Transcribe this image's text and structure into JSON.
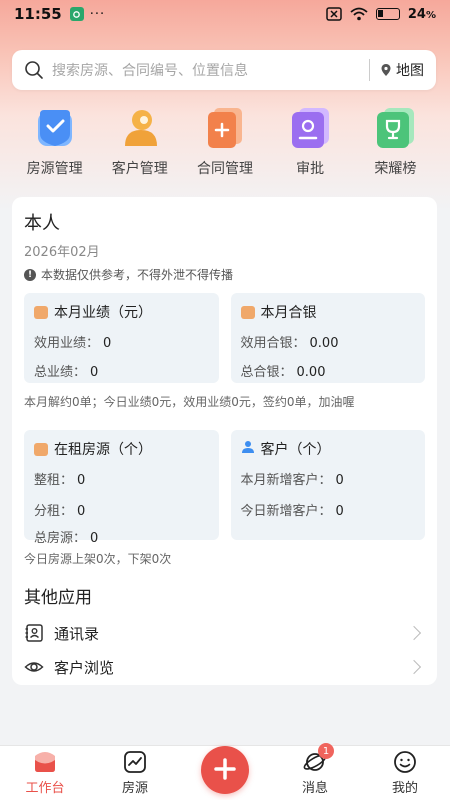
{
  "status": {
    "time": "11:55",
    "dots": "···",
    "battery": "24",
    "battery_unit": "%"
  },
  "search": {
    "placeholder": "搜索房源、合同编号、位置信息",
    "map_label": "地图"
  },
  "quick_actions": [
    {
      "label": "房源管理",
      "icon": "check-shield-icon",
      "color": "#4a8ff5"
    },
    {
      "label": "客户管理",
      "icon": "person-icon",
      "color": "#f0a23a"
    },
    {
      "label": "合同管理",
      "icon": "doc-plus-icon",
      "color": "#f2814b"
    },
    {
      "label": "审批",
      "icon": "approval-icon",
      "color": "#9b6ef0"
    },
    {
      "label": "荣耀榜",
      "icon": "trophy-icon",
      "color": "#4cc47a"
    }
  ],
  "card": {
    "title": "本人",
    "date": "2026年02月",
    "notice": "本数据仅供参考，不得外泄不得传播",
    "notice_icon": "!",
    "perf": {
      "title": "本月业绩（元）",
      "row1_label": "效用业绩：",
      "row1_value": "0",
      "row2_label": "总业绩：",
      "row2_value": "0"
    },
    "silver": {
      "title": "本月合银",
      "row1_label": "效用合银：",
      "row1_value": "0.00",
      "row2_label": "总合银：",
      "row2_value": "0.00"
    },
    "summary1": "本月解约0单；今日业绩0元，效用业绩0元，签约0单，加油喔",
    "rent": {
      "title": "在租房源（个）",
      "row1_label": "整租：",
      "row1_value": "0",
      "row2_label": "分租：",
      "row2_value": "0",
      "row3_label": "总房源：",
      "row3_value": "0"
    },
    "customer": {
      "title": "客户（个）",
      "row1_label": "本月新增客户：",
      "row1_value": "0",
      "row2_label": "今日新增客户：",
      "row2_value": "0"
    },
    "summary2": "今日房源上架0次，下架0次",
    "other_title": "其他应用",
    "other_items": [
      {
        "label": "通讯录",
        "icon": "contacts-icon"
      },
      {
        "label": "客户浏览",
        "icon": "eye-icon"
      }
    ]
  },
  "tabbar": {
    "items": [
      {
        "label": "工作台",
        "icon": "workbench-icon"
      },
      {
        "label": "房源",
        "icon": "trend-icon"
      },
      {
        "label": "",
        "icon": "plus-icon"
      },
      {
        "label": "消息",
        "icon": "planet-icon",
        "badge": "1"
      },
      {
        "label": "我的",
        "icon": "smile-icon"
      }
    ]
  },
  "colors": {
    "accent": "#e9514a",
    "box_bg": "#eef3f7"
  }
}
